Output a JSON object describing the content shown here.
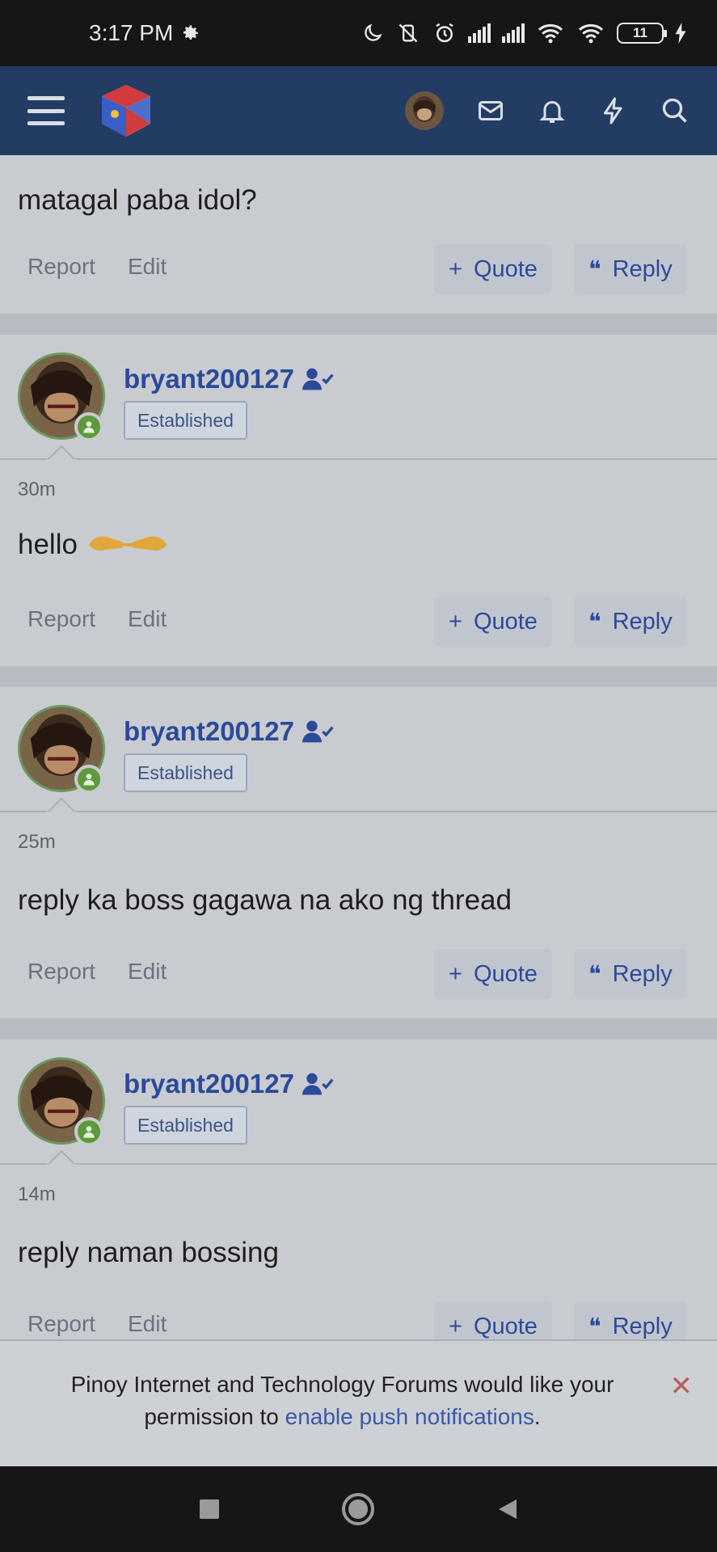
{
  "status_bar": {
    "time": "3:17 PM",
    "battery": "11",
    "icons": [
      "gear-icon",
      "moon-icon",
      "vibrate-off-icon",
      "alarm-icon",
      "signal-icon",
      "signal-icon",
      "wifi-icon",
      "wifi-icon",
      "battery-icon",
      "charging-icon"
    ]
  },
  "header": {
    "icons": [
      "menu-icon",
      "site-logo",
      "user-avatar",
      "mail-icon",
      "bell-icon",
      "bolt-icon",
      "search-icon"
    ]
  },
  "actions": {
    "report": "Report",
    "edit": "Edit",
    "quote": "Quote",
    "reply": "Reply"
  },
  "posts": [
    {
      "text": "matagal paba idol?"
    },
    {
      "username": "bryant200127",
      "badge": "Established",
      "time": "30m",
      "text": "hello"
    },
    {
      "username": "bryant200127",
      "badge": "Established",
      "time": "25m",
      "text": "reply ka boss gagawa na ako ng thread"
    },
    {
      "username": "bryant200127",
      "badge": "Established",
      "time": "14m",
      "text": "reply naman bossing"
    }
  ],
  "notice": {
    "text_before": "Pinoy Internet and Technology Forums would like your permission to ",
    "link": "enable push notifications",
    "text_after": "."
  },
  "colors": {
    "header_bg": "#233c63",
    "link_blue": "#2c4a9a",
    "online_green": "#5e9a3c"
  }
}
